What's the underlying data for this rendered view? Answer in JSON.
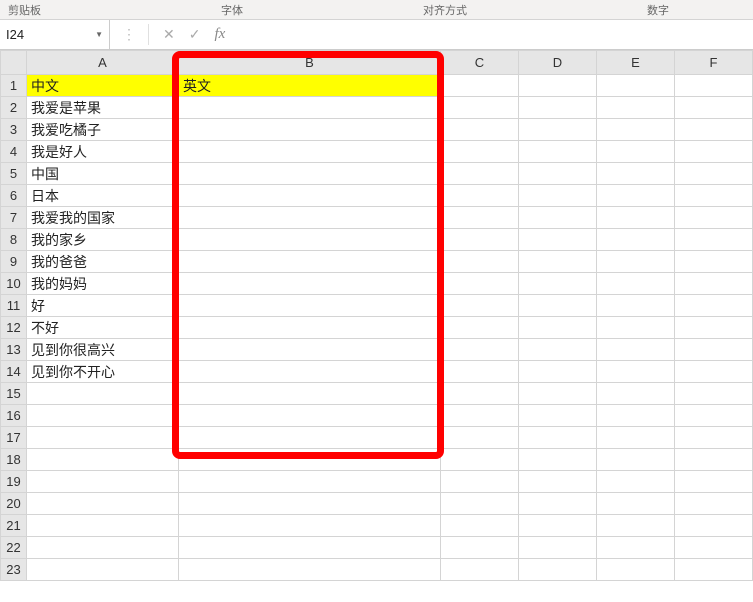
{
  "ribbon": {
    "clipboard_label": "剪贴板",
    "font_label": "字体",
    "align_label": "对齐方式",
    "number_label": "数字"
  },
  "formula_bar": {
    "namebox_value": "I24",
    "fx_label": "fx",
    "input_value": ""
  },
  "grid": {
    "col_headers": [
      "A",
      "B",
      "C",
      "D",
      "E",
      "F"
    ],
    "row_headers": [
      "1",
      "2",
      "3",
      "4",
      "5",
      "6",
      "7",
      "8",
      "9",
      "10",
      "11",
      "12",
      "13",
      "14",
      "15",
      "16",
      "17",
      "18",
      "19",
      "20",
      "21",
      "22",
      "23"
    ],
    "header_row": {
      "A": "中文",
      "B": "英文"
    },
    "data_rows": [
      "我爱是苹果",
      "我爱吃橘子",
      "我是好人",
      "中国",
      "日本",
      "我爱我的国家",
      "我的家乡",
      "我的爸爸",
      "我的妈妈",
      "好",
      "不好",
      "见到你很高兴",
      "见到你不开心"
    ]
  },
  "icons": {
    "dropdown": "▼",
    "cancel": "✕",
    "confirm": "✓"
  }
}
